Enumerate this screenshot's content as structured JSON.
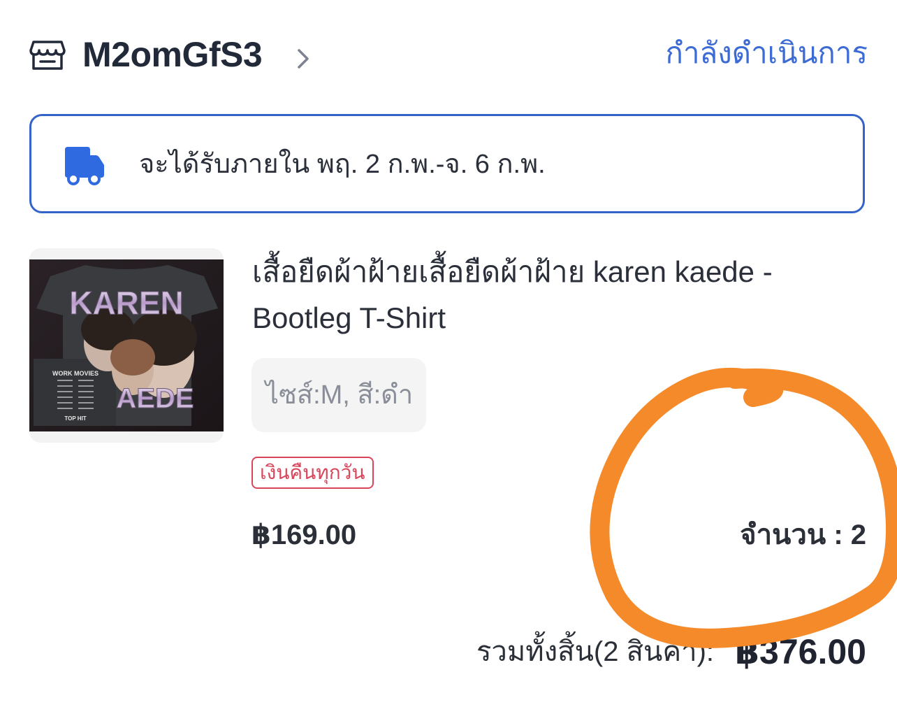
{
  "shop": {
    "name": "M2omGfS3",
    "status": "กำลังดำเนินการ"
  },
  "delivery": {
    "text": "จะได้รับภายใน พฤ. 2 ก.พ.-จ. 6 ก.พ."
  },
  "product": {
    "title_line1": "เสื้อยืดผ้าฝ้ายเสื้อยืดผ้าฝ้าย karen kaede -",
    "title_line2": "Bootleg T-Shirt",
    "variant": "ไซส์:M, สี:ดำ",
    "badge": "เงินคืนทุกวัน",
    "price": "฿169.00",
    "quantity": "จำนวน : 2",
    "image_text": {
      "name_top": "KAREN",
      "name_bottom": "AEDE",
      "back_title": "WORK MOVIES",
      "back_footer": "TOP HIT"
    }
  },
  "total": {
    "label": "รวมทั้งสิ้น(2 สินค้า):",
    "value": "฿376.00"
  },
  "colors": {
    "accent_blue": "#3463c9",
    "status_blue": "#3d6bd6",
    "badge_red": "#d9455a",
    "annotation_orange": "#f58a2a"
  }
}
